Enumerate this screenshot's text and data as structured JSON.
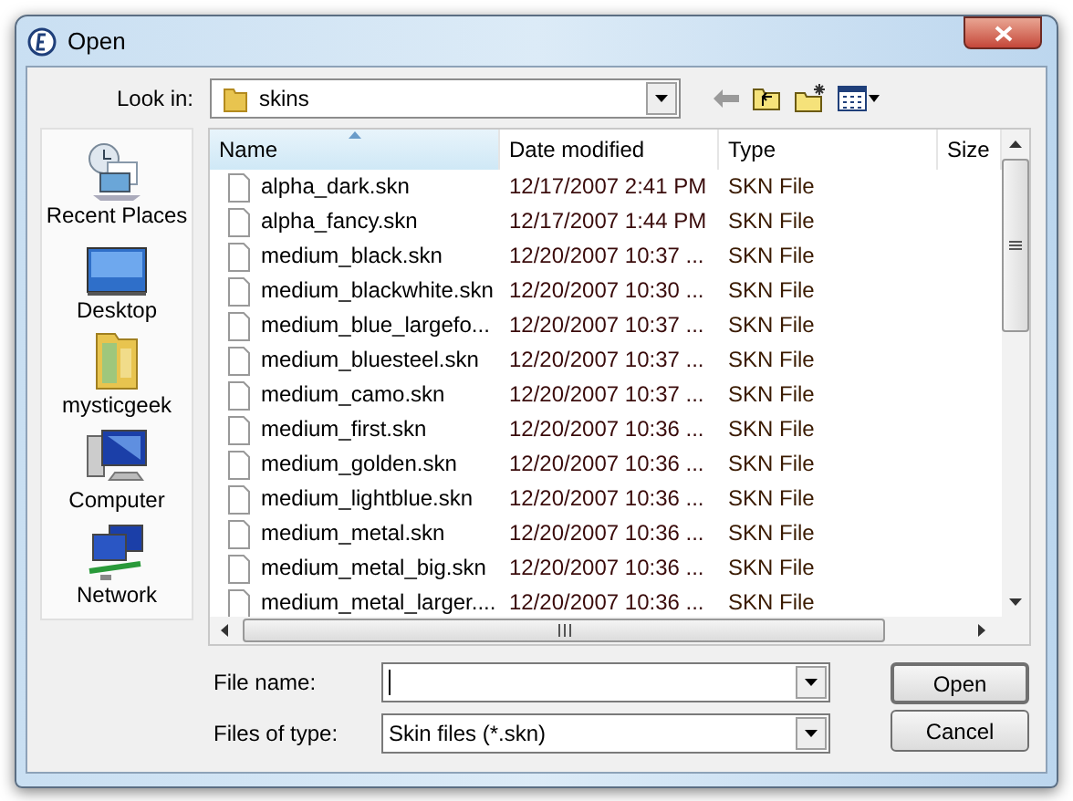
{
  "window": {
    "title": "Open"
  },
  "look_in": {
    "label": "Look in:",
    "value": "skins"
  },
  "places": [
    {
      "kind": "recent",
      "label": "Recent Places"
    },
    {
      "kind": "desktop",
      "label": "Desktop"
    },
    {
      "kind": "user",
      "label": "mysticgeek"
    },
    {
      "kind": "computer",
      "label": "Computer"
    },
    {
      "kind": "network",
      "label": "Network"
    }
  ],
  "table": {
    "columns": [
      {
        "label": "Name",
        "sorted": true
      },
      {
        "label": "Date modified",
        "sorted": false
      },
      {
        "label": "Type",
        "sorted": false
      },
      {
        "label": "Size",
        "sorted": false
      }
    ],
    "rows": [
      [
        "alpha_dark.skn",
        "12/17/2007 2:41 PM",
        "SKN File"
      ],
      [
        "alpha_fancy.skn",
        "12/17/2007 1:44 PM",
        "SKN File"
      ],
      [
        "medium_black.skn",
        "12/20/2007 10:37 ...",
        "SKN File"
      ],
      [
        "medium_blackwhite.skn",
        "12/20/2007 10:30 ...",
        "SKN File"
      ],
      [
        "medium_blue_largefo...",
        "12/20/2007 10:37 ...",
        "SKN File"
      ],
      [
        "medium_bluesteel.skn",
        "12/20/2007 10:37 ...",
        "SKN File"
      ],
      [
        "medium_camo.skn",
        "12/20/2007 10:37 ...",
        "SKN File"
      ],
      [
        "medium_first.skn",
        "12/20/2007 10:36 ...",
        "SKN File"
      ],
      [
        "medium_golden.skn",
        "12/20/2007 10:36 ...",
        "SKN File"
      ],
      [
        "medium_lightblue.skn",
        "12/20/2007 10:36 ...",
        "SKN File"
      ],
      [
        "medium_metal.skn",
        "12/20/2007 10:36 ...",
        "SKN File"
      ],
      [
        "medium_metal_big.skn",
        "12/20/2007 10:36 ...",
        "SKN File"
      ],
      [
        "medium_metal_larger....",
        "12/20/2007 10:36 ...",
        "SKN File"
      ]
    ]
  },
  "file_name": {
    "label": "File name:"
  },
  "file_type": {
    "label": "Files of type:",
    "value": "Skin files (*.skn)"
  },
  "buttons": [
    "Open",
    "Cancel"
  ]
}
